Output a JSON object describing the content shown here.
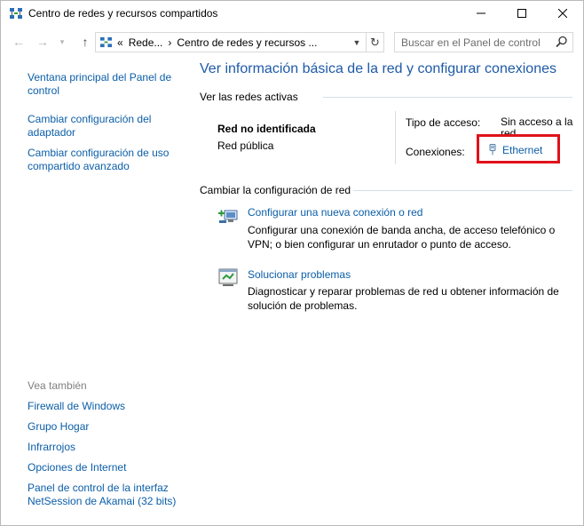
{
  "window": {
    "title": "Centro de redes y recursos compartidos"
  },
  "address": {
    "overflow": "«",
    "crumbs": [
      "Rede...",
      "›",
      "Centro de redes y recursos ..."
    ],
    "search_placeholder": "Buscar en el Panel de control"
  },
  "sidebar": {
    "items": [
      {
        "label": "Ventana principal del Panel de control"
      },
      {
        "label": "Cambiar configuración del adaptador"
      },
      {
        "label": "Cambiar configuración de uso compartido avanzado"
      }
    ],
    "see_also_label": "Vea también",
    "see_also": [
      {
        "label": "Firewall de Windows"
      },
      {
        "label": "Grupo Hogar"
      },
      {
        "label": "Infrarrojos"
      },
      {
        "label": "Opciones de Internet"
      },
      {
        "label": "Panel de control de la interfaz NetSession de Akamai (32 bits)"
      }
    ]
  },
  "main": {
    "title": "Ver información básica de la red y configurar conexiones",
    "active_networks_header": "Ver las redes activas",
    "network": {
      "name": "Red no identificada",
      "type": "Red pública",
      "access_label": "Tipo de acceso:",
      "access_value": "Sin acceso a la red",
      "connections_label": "Conexiones:",
      "connection_value": "Ethernet"
    },
    "change_header": "Cambiar la configuración de red",
    "tasks": [
      {
        "link": "Configurar una nueva conexión o red",
        "desc": "Configurar una conexión de banda ancha, de acceso telefónico o VPN; o bien configurar un enrutador o punto de acceso."
      },
      {
        "link": "Solucionar problemas",
        "desc": "Diagnosticar y reparar problemas de red u obtener información de solución de problemas."
      }
    ]
  },
  "colors": {
    "link": "#0b5ea8",
    "title": "#1e5aa8",
    "highlight": "#e0121a"
  }
}
